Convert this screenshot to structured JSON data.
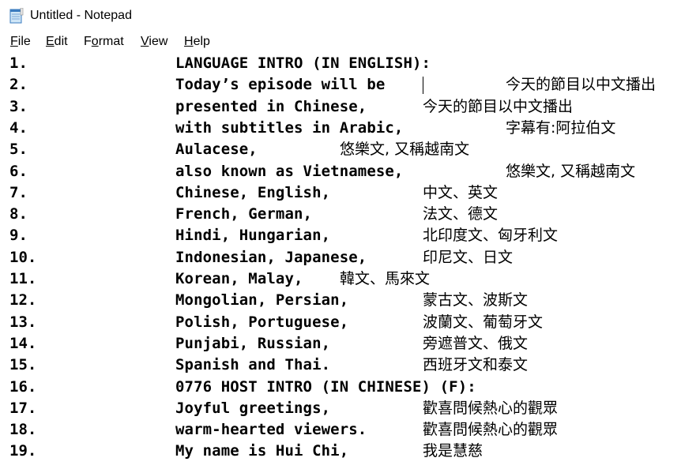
{
  "window": {
    "title": "Untitled - Notepad",
    "icon": "notepad-icon"
  },
  "menu": [
    {
      "label": "File",
      "accel": "F",
      "rest": "ile"
    },
    {
      "label": "Edit",
      "accel": "E",
      "rest": "dit"
    },
    {
      "label": "Format",
      "pre": "F",
      "accel": "o",
      "rest": "rmat"
    },
    {
      "label": "View",
      "accel": "V",
      "rest": "iew"
    },
    {
      "label": "Help",
      "accel": "H",
      "rest": "elp"
    }
  ],
  "lines": [
    {
      "num": "1.",
      "en": "LANGUAGE INTRO (IN ENGLISH):",
      "zh": ""
    },
    {
      "num": "2.",
      "en": "Today’s episode will be ",
      "zh": "今天的節目以中文播出"
    },
    {
      "num": "3.",
      "en": "presented in Chinese,",
      "zh": "今天的節目以中文播出"
    },
    {
      "num": "4.",
      "en": "with subtitles in Arabic,",
      "zh": "字幕有:阿拉伯文"
    },
    {
      "num": "5.",
      "en": "Aulacese,",
      "zh": "悠樂文, 又稱越南文"
    },
    {
      "num": "6.",
      "en": "also known as Vietnamese,",
      "zh": "悠樂文, 又稱越南文"
    },
    {
      "num": "7.",
      "en": "Chinese, English,",
      "zh": "中文、英文"
    },
    {
      "num": "8.",
      "en": "French, German,",
      "zh": "法文、德文"
    },
    {
      "num": "9.",
      "en": "Hindi, Hungarian,",
      "zh": "北印度文、匈牙利文"
    },
    {
      "num": "10.",
      "en": "Indonesian, Japanese,",
      "zh": "印尼文、日文"
    },
    {
      "num": "11.",
      "en": "Korean, Malay,",
      "zh": "韓文、馬來文"
    },
    {
      "num": "12.",
      "en": "Mongolian, Persian,",
      "zh": "蒙古文、波斯文"
    },
    {
      "num": "13.",
      "en": "Polish, Portuguese,",
      "zh": "波蘭文、葡萄牙文"
    },
    {
      "num": "14.",
      "en": "Punjabi, Russian,",
      "zh": "旁遮普文、俄文"
    },
    {
      "num": "15.",
      "en": "Spanish and Thai.",
      "zh": "西班牙文和泰文"
    },
    {
      "num": "16.",
      "en": "0776 HOST INTRO (IN CHINESE) (F):",
      "zh": ""
    },
    {
      "num": "17.",
      "en": "Joyful greetings,",
      "zh": "歡喜問候熱心的觀眾"
    },
    {
      "num": "18.",
      "en": "warm-hearted viewers.",
      "zh": "歡喜問候熱心的觀眾"
    },
    {
      "num": "19.",
      "en": "My name is Hui Chi,",
      "zh": "我是慧慈"
    }
  ]
}
